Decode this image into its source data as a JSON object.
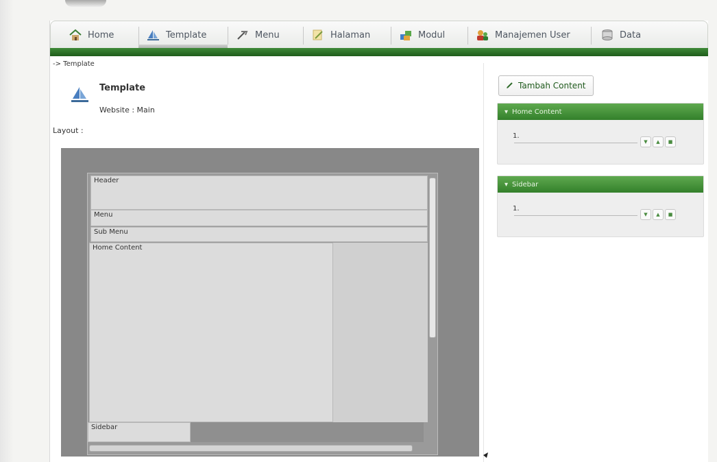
{
  "nav": {
    "items": [
      {
        "label": "Home",
        "icon": "home-icon"
      },
      {
        "label": "Template",
        "icon": "template-icon"
      },
      {
        "label": "Menu",
        "icon": "menu-icon"
      },
      {
        "label": "Halaman",
        "icon": "page-icon"
      },
      {
        "label": "Modul",
        "icon": "module-icon"
      },
      {
        "label": "Manajemen User",
        "icon": "user-management-icon"
      },
      {
        "label": "Data",
        "icon": "data-icon"
      }
    ],
    "active": "Template"
  },
  "breadcrumb": "-> Template",
  "template": {
    "title": "Template",
    "website": "Website : Main",
    "layout_label": "Layout :"
  },
  "preview": {
    "header": "Header",
    "menu": "Menu",
    "sub_menu": "Sub Menu",
    "home_content": "Home Content",
    "sidebar": "Sidebar"
  },
  "sidebar_panel": {
    "add_button": "Tambah Content",
    "panels": [
      {
        "title": "Home Content",
        "rows": [
          {
            "num": "1."
          }
        ]
      },
      {
        "title": "Sidebar",
        "rows": [
          {
            "num": "1."
          }
        ]
      }
    ]
  },
  "colors": {
    "nav_green": "#2a6e25",
    "panel_green": "#4a9a3f",
    "preview_gray": "#888888"
  }
}
